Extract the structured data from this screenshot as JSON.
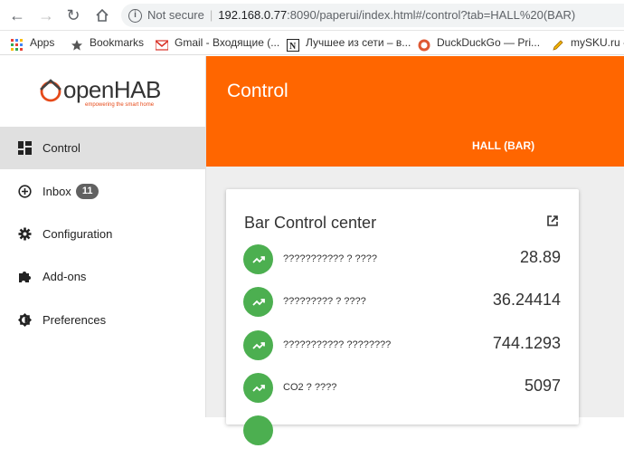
{
  "browser": {
    "security_label": "Not secure",
    "url_host": "192.168.0.77",
    "url_path": ":8090/paperui/index.html#/control?tab=HALL%20(BAR)"
  },
  "bookmarks": [
    {
      "label": "Apps",
      "icon": "apps-grid-icon"
    },
    {
      "label": "Bookmarks",
      "icon": "star-icon"
    },
    {
      "label": "Gmail - Входящие (...",
      "icon": "gmail-icon"
    },
    {
      "label": "Лучшее из сети – в...",
      "icon": "notion-icon"
    },
    {
      "label": "DuckDuckGo — Pri...",
      "icon": "duckduckgo-icon"
    },
    {
      "label": "mySKU.ru -",
      "icon": "pencil-icon"
    }
  ],
  "sidebar": {
    "logo_text": "openHAB",
    "logo_tagline": "empowering the smart home",
    "items": [
      {
        "label": "Control",
        "icon": "dashboard-icon",
        "active": true
      },
      {
        "label": "Inbox",
        "icon": "add-circle-icon",
        "badge": "11"
      },
      {
        "label": "Configuration",
        "icon": "gear-icon"
      },
      {
        "label": "Add-ons",
        "icon": "puzzle-icon"
      },
      {
        "label": "Preferences",
        "icon": "brightness-icon"
      }
    ]
  },
  "header": {
    "title": "Control",
    "active_tab": "HALL (BAR)"
  },
  "card": {
    "title": "Bar Control center",
    "rows": [
      {
        "label": "??????????? ? ????",
        "value": "28.89",
        "icon": "trending-up-icon"
      },
      {
        "label": "????????? ? ????",
        "value": "36.24414",
        "icon": "trending-up-icon"
      },
      {
        "label": "??????????? ????????",
        "value": "744.1293",
        "icon": "trending-up-icon"
      },
      {
        "label": "CO2 ? ????",
        "value": "5097",
        "icon": "trending-up-icon"
      }
    ]
  },
  "colors": {
    "accent": "#ff6600",
    "row_icon": "#4caf50",
    "sidebar_active": "#e0e0e0",
    "content_bg": "#eeeeee"
  }
}
